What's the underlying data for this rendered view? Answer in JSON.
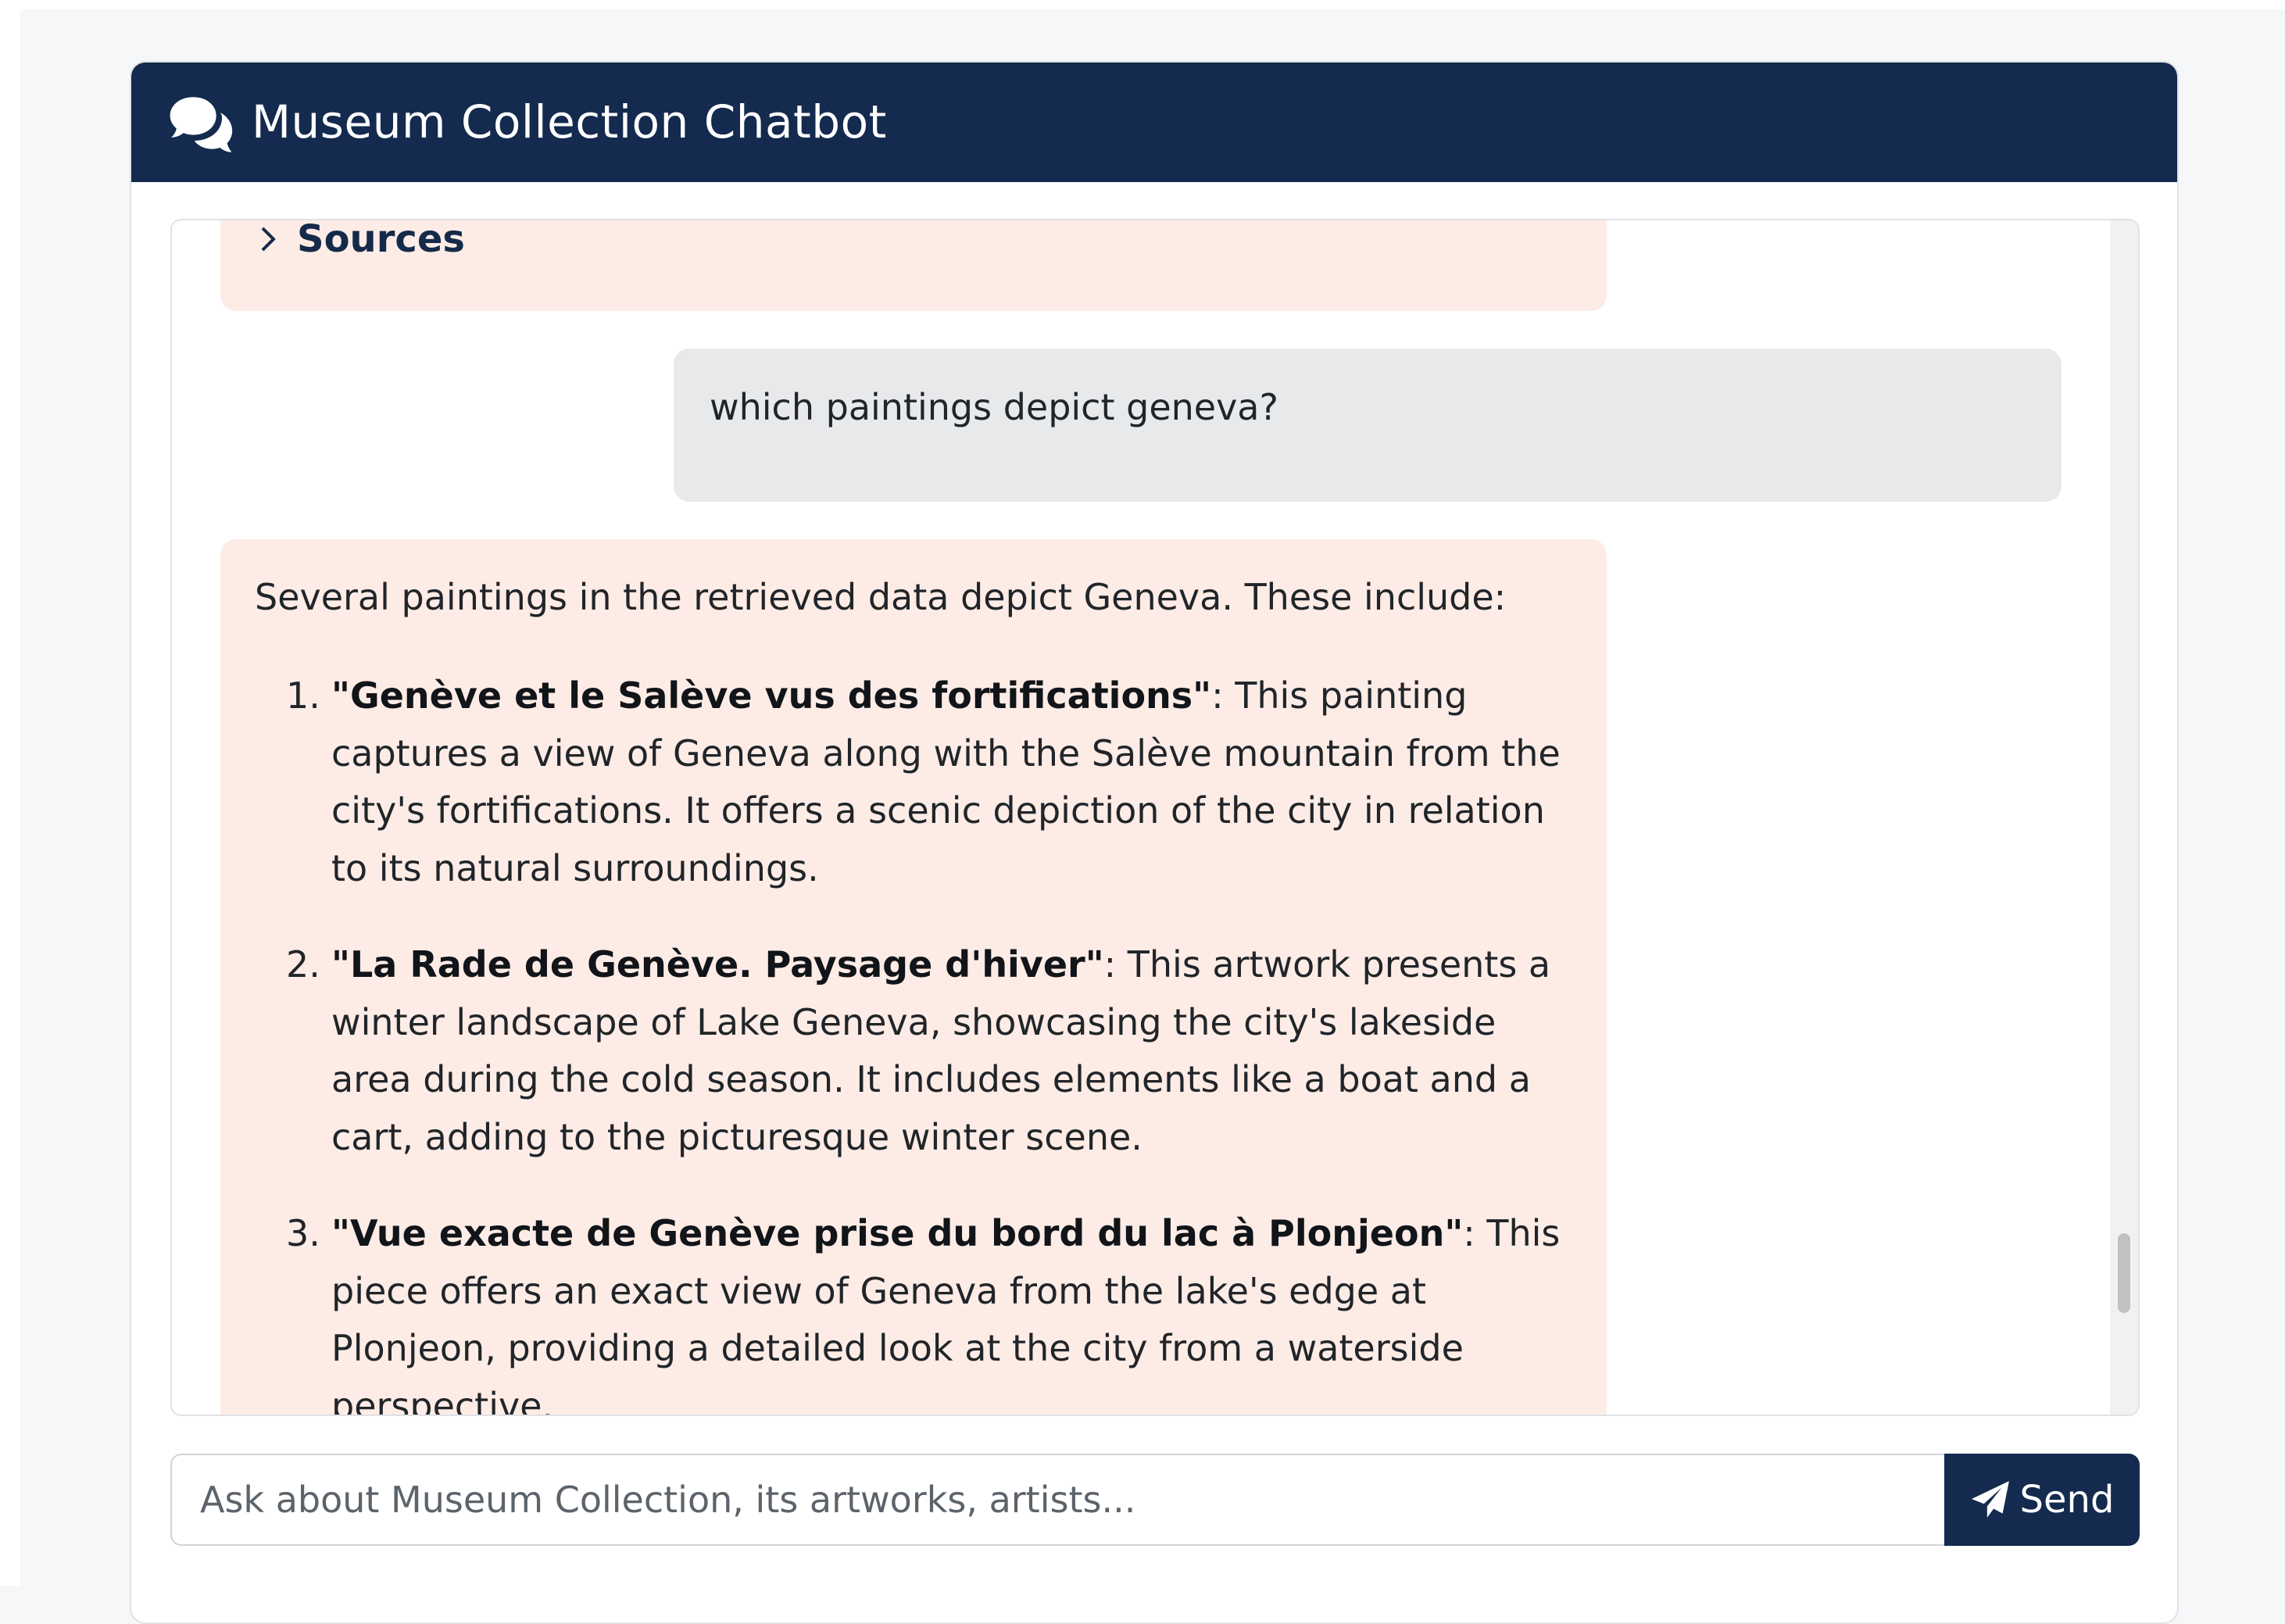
{
  "app": {
    "title": "Museum Collection Chatbot",
    "icon": "comments-icon"
  },
  "colors": {
    "header_bg": "#142a4f",
    "bot_bubble": "#fdece6",
    "user_bubble": "#e8e9eb",
    "send_button": "#142a4f"
  },
  "messages": {
    "previous_bot": {
      "sources_label": "Sources",
      "icon": "chevron-right-icon"
    },
    "user": {
      "text": "which paintings depict geneva?"
    },
    "bot": {
      "intro": "Several paintings in the retrieved data depict Geneva. These include:",
      "items": [
        {
          "number": "1.",
          "title": "\"Genève et le Salève vus des fortifications\"",
          "text": ": This painting captures a view of Geneva along with the Salève mountain from the city's fortifications. It offers a scenic depiction of the city in relation to its natural surroundings."
        },
        {
          "number": "2.",
          "title": "\"La Rade de Genève. Paysage d'hiver\"",
          "text": ": This artwork presents a winter landscape of Lake Geneva, showcasing the city's lakeside area during the cold season. It includes elements like a boat and a cart, adding to the picturesque winter scene."
        },
        {
          "number": "3.",
          "title": "\"Vue exacte de Genève prise du bord du lac à Plonjeon\"",
          "text": ": This piece offers an exact view of Geneva from the lake's edge at Plonjeon, providing a detailed look at the city from a waterside perspective."
        }
      ]
    }
  },
  "input": {
    "value": "",
    "placeholder": "Ask about Museum Collection, its artworks, artists..."
  },
  "send": {
    "label": "Send",
    "icon": "paper-plane-icon"
  }
}
